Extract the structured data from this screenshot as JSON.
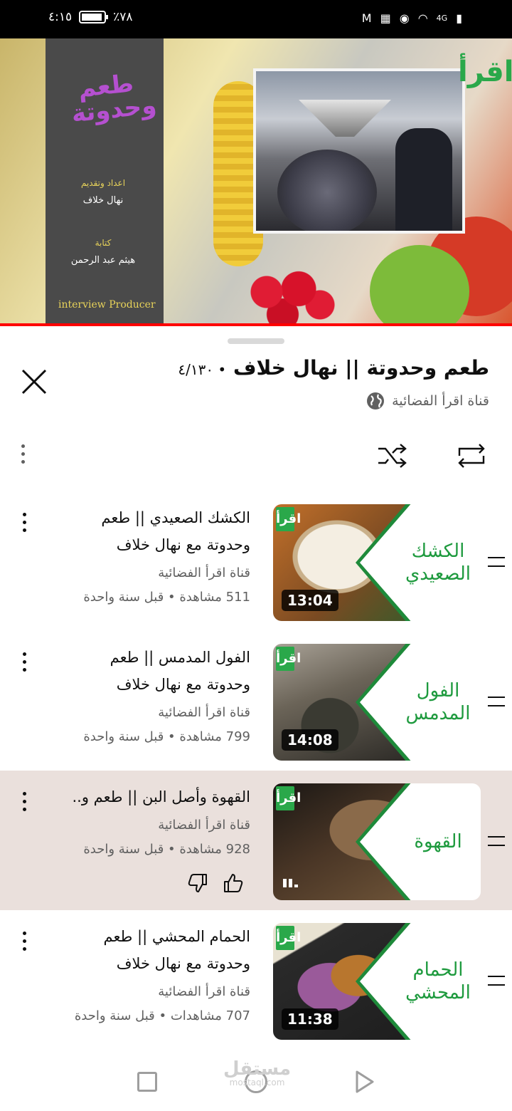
{
  "status_bar": {
    "time": "٤:١٥",
    "battery": "٪٧٨",
    "network": "4G"
  },
  "player": {
    "credits": {
      "logo_text": "طعم وحدوتة",
      "role1": "اعداد وتقديم",
      "name1": "نهال خلاف",
      "role2": "كتابة",
      "name2": "هيثم عبد الرحمن",
      "producer_label": "interview Producer"
    },
    "channel_logo": "اقرأ",
    "progress_color": "#ff0000"
  },
  "playlist": {
    "title": "طعم وحدوتة || نهال خلاف",
    "position": "٤/١٣٠",
    "channel": "قناة اقرأ الفضائية",
    "privacy_icon": "globe-icon",
    "controls": {
      "shuffle_icon": "shuffle-icon",
      "loop_icon": "loop-icon",
      "more_icon": "more-vert-icon"
    }
  },
  "items": [
    {
      "title": "الكشك الصعيدي || طعم وحدوتة مع نهال خلاف",
      "channel": "قناة اقرأ الفضائية",
      "meta": "511 مشاهدة • قبل سنة واحدة",
      "duration": "13:04",
      "thumb_label": "الكشك الصعيدي",
      "logo": "اقرأ",
      "playing": false
    },
    {
      "title": "الفول المدمس || طعم وحدوتة مع نهال خلاف",
      "channel": "قناة اقرأ الفضائية",
      "meta": "799 مشاهدة • قبل سنة واحدة",
      "duration": "14:08",
      "thumb_label": "الفول المدمس",
      "logo": "اقرأ",
      "playing": false
    },
    {
      "title": "القهوة وأصل البن || طعم و...",
      "channel": "قناة اقرأ الفضائية",
      "meta": "928 مشاهدة • قبل سنة واحدة",
      "duration": "",
      "thumb_label": "القهوة",
      "logo": "اقرأ",
      "playing": true,
      "actions": {
        "like_icon": "thumb-up-icon",
        "dislike_icon": "thumb-down-icon"
      }
    },
    {
      "title": "الحمام المحشي || طعم وحدوتة مع نهال خلاف",
      "channel": "قناة اقرأ الفضائية",
      "meta": "707 مشاهدات • قبل سنة واحدة",
      "duration": "11:38",
      "thumb_label": "الحمام المحشي",
      "logo": "اقرأ",
      "playing": false
    }
  ],
  "watermark": {
    "arabic": "مستقل",
    "latin": "mostaql.com"
  },
  "colors": {
    "accent_green": "#1e9a3e",
    "active_row": "#eae0dc",
    "secondary_text": "#606060"
  }
}
